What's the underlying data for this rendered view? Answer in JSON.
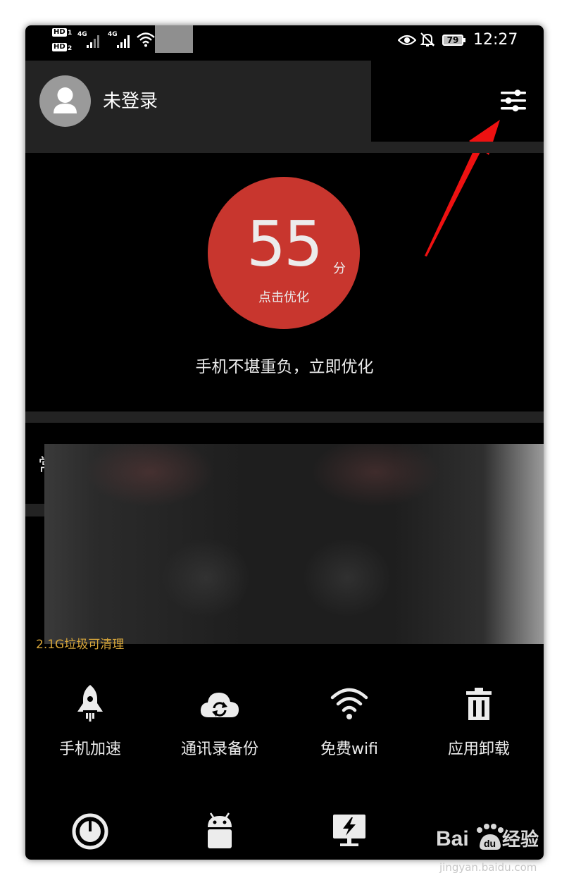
{
  "status_bar": {
    "hd_label": "HD",
    "sim1_index": "1",
    "sim2_index": "2",
    "sim1_network": "4G",
    "sim2_network": "4G",
    "battery": "79",
    "time": "12:27",
    "icons": [
      "eye-icon",
      "bell-off-icon",
      "wifi-icon",
      "signal-icon",
      "battery-icon"
    ]
  },
  "header": {
    "login_text": "未登录",
    "settings_icon": "sliders-icon"
  },
  "score": {
    "value": "55",
    "unit": "分",
    "action": "点击优化",
    "tip": "手机不堪重负，立即优化",
    "circle_color": "#c8362e"
  },
  "cleanup": {
    "partial_label": "常",
    "junk_text": "2.1G垃圾可清理",
    "junk_color": "#d6a53a"
  },
  "tools_row1": [
    {
      "label": "手机加速",
      "icon": "rocket-icon"
    },
    {
      "label": "通讯录备份",
      "icon": "cloud-sync-icon"
    },
    {
      "label": "免费wifi",
      "icon": "wifi-icon"
    },
    {
      "label": "应用卸载",
      "icon": "trash-icon"
    }
  ],
  "tools_row2": [
    {
      "icon": "timer-icon"
    },
    {
      "icon": "android-icon"
    },
    {
      "icon": "monitor-bolt-icon"
    }
  ],
  "watermark": {
    "brand_left": "Bai",
    "brand_right": "经验",
    "url": "jingyan.baidu.com"
  }
}
